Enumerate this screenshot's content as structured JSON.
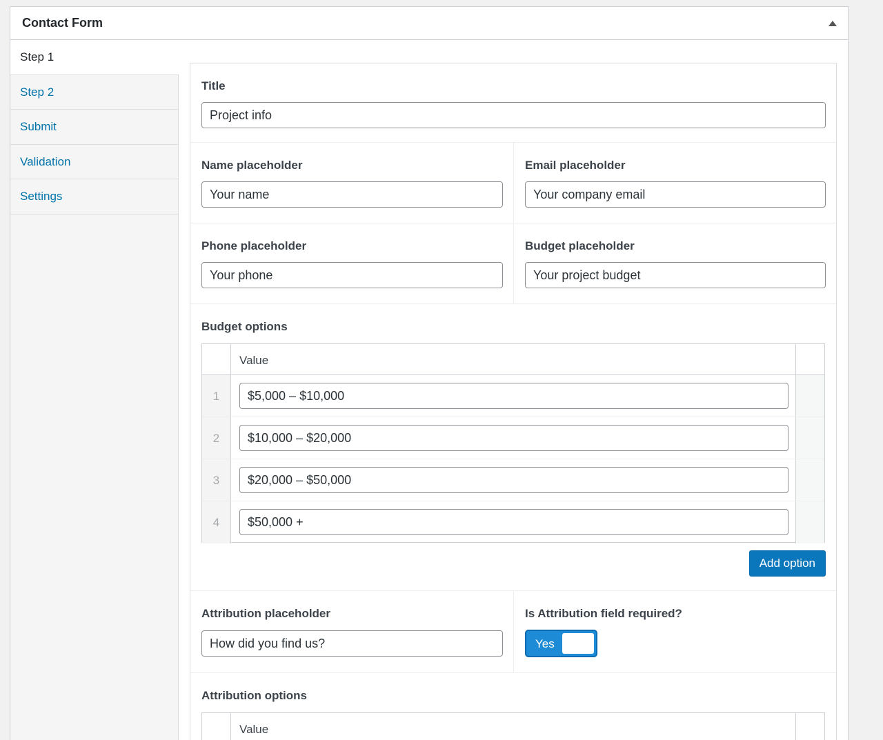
{
  "panel": {
    "title": "Contact Form"
  },
  "tabs": [
    {
      "label": "Step 1",
      "active": true
    },
    {
      "label": "Step 2",
      "active": false
    },
    {
      "label": "Submit",
      "active": false
    },
    {
      "label": "Validation",
      "active": false
    },
    {
      "label": "Settings",
      "active": false
    }
  ],
  "fields": {
    "title": {
      "label": "Title",
      "value": "Project info"
    },
    "name_placeholder": {
      "label": "Name placeholder",
      "value": "Your name"
    },
    "email_placeholder": {
      "label": "Email placeholder",
      "value": "Your company email"
    },
    "phone_placeholder": {
      "label": "Phone placeholder",
      "value": "Your phone"
    },
    "budget_placeholder": {
      "label": "Budget placeholder",
      "value": "Your project budget"
    },
    "budget_options": {
      "label": "Budget options",
      "column": "Value",
      "rows": [
        {
          "index": "1",
          "value": "$5,000 – $10,000"
        },
        {
          "index": "2",
          "value": "$10,000 – $20,000"
        },
        {
          "index": "3",
          "value": "$20,000 – $50,000"
        },
        {
          "index": "4",
          "value": "$50,000 +"
        }
      ],
      "add_label": "Add option"
    },
    "attribution_placeholder": {
      "label": "Attribution placeholder",
      "value": "How did you find us?"
    },
    "attribution_required": {
      "label": "Is Attribution field required?",
      "toggle_label": "Yes",
      "on": true
    },
    "attribution_options": {
      "label": "Attribution options",
      "column": "Value"
    }
  },
  "colors": {
    "accent": "#0a77bd",
    "link": "#0073aa",
    "toggle_on": "#1e8bd6"
  }
}
